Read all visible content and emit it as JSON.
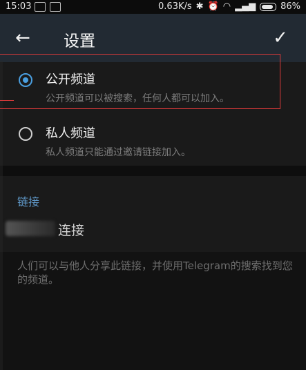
{
  "status": {
    "time": "15:03",
    "speed": "0.63K/s",
    "battery": "86%"
  },
  "header": {
    "title": "设置"
  },
  "options": [
    {
      "title": "公开频道",
      "subtitle": "公开频道可以被搜索，任何人都可以加入。",
      "checked": true
    },
    {
      "title": "私人频道",
      "subtitle": "私人频道只能通过邀请链接加入。",
      "checked": false
    }
  ],
  "link_section": {
    "header": "链接",
    "link_label": "连接",
    "description": "人们可以与他人分享此链接，并使用Telegram的搜索找到您的频道。"
  },
  "colors": {
    "accent": "#4a9fe0",
    "appbar": "#222a33",
    "highlight": "#e23b3b"
  }
}
